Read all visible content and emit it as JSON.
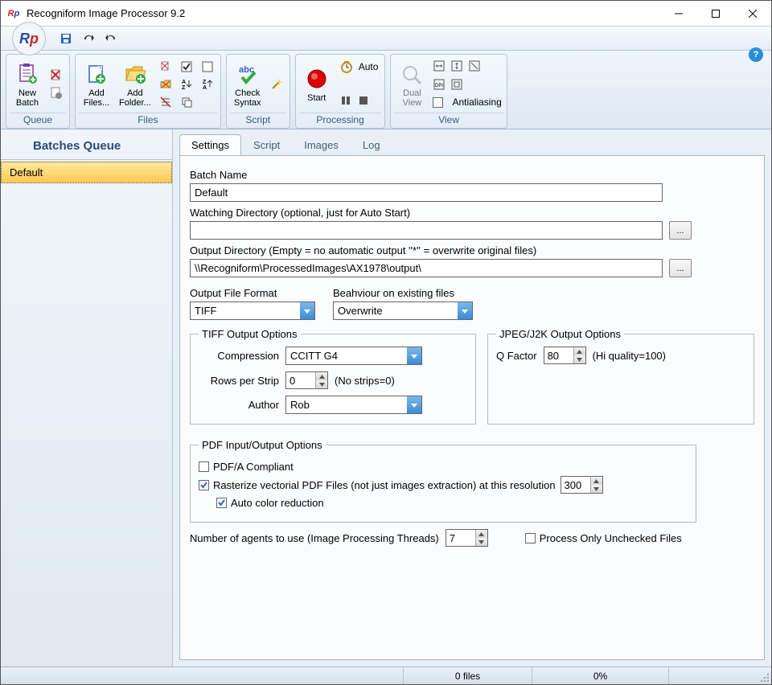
{
  "window": {
    "title": "Recogniform Image Processor 9.2"
  },
  "ribbon": {
    "queue": {
      "caption": "Queue",
      "newBatch": "New\nBatch"
    },
    "files": {
      "caption": "Files",
      "addFiles": "Add\nFiles...",
      "addFolder": "Add\nFolder..."
    },
    "script": {
      "caption": "Script",
      "checkSyntax": "Check\nSyntax"
    },
    "processing": {
      "caption": "Processing",
      "start": "Start",
      "auto": "Auto"
    },
    "view": {
      "caption": "View",
      "dualView": "Dual\nView",
      "antialiasing": "Antialiasing"
    }
  },
  "sidebar": {
    "header": "Batches  Queue",
    "items": [
      {
        "label": "Default"
      }
    ]
  },
  "tabs": {
    "settings": "Settings",
    "script": "Script",
    "images": "Images",
    "log": "Log"
  },
  "settings": {
    "batchNameLabel": "Batch Name",
    "batchName": "Default",
    "watchDirLabel": "Watching Directory (optional, just for Auto Start)",
    "watchDir": "",
    "outDirLabel": "Output Directory (Empty = no automatic output   ''*'' = overwrite original files)",
    "outDir": "\\\\Recogniform\\ProcessedImages\\AX1978\\output\\",
    "outFmtLabel": "Output File Format",
    "outFmt": "TIFF",
    "behaviourLabel": "Beahviour on existing files",
    "behaviour": "Overwrite",
    "tiff": {
      "legend": "TIFF Output Options",
      "compressionLabel": "Compression",
      "compression": "CCITT G4",
      "rowsPerStripLabel": "Rows per Strip",
      "rowsPerStrip": "0",
      "rowsPerStripHint": "(No strips=0)",
      "authorLabel": "Author",
      "author": "Rob"
    },
    "jpeg": {
      "legend": "JPEG/J2K Output Options",
      "qFactorLabel": "Q Factor",
      "qFactor": "80",
      "qFactorHint": "(Hi quality=100)"
    },
    "pdf": {
      "legend": "PDF Input/Output Options",
      "pdfaCompliant": "PDF/A Compliant",
      "rasterize": "Rasterize vectorial PDF Files (not just images extraction) at this resolution",
      "rasterizeDpi": "300",
      "autoColorReduction": "Auto color reduction"
    },
    "agentsLabel": "Number of agents to use (Image Processing Threads)",
    "agents": "7",
    "processOnlyUnchecked": "Process Only Unchecked Files"
  },
  "status": {
    "files": "0 files",
    "pct": "0%"
  }
}
